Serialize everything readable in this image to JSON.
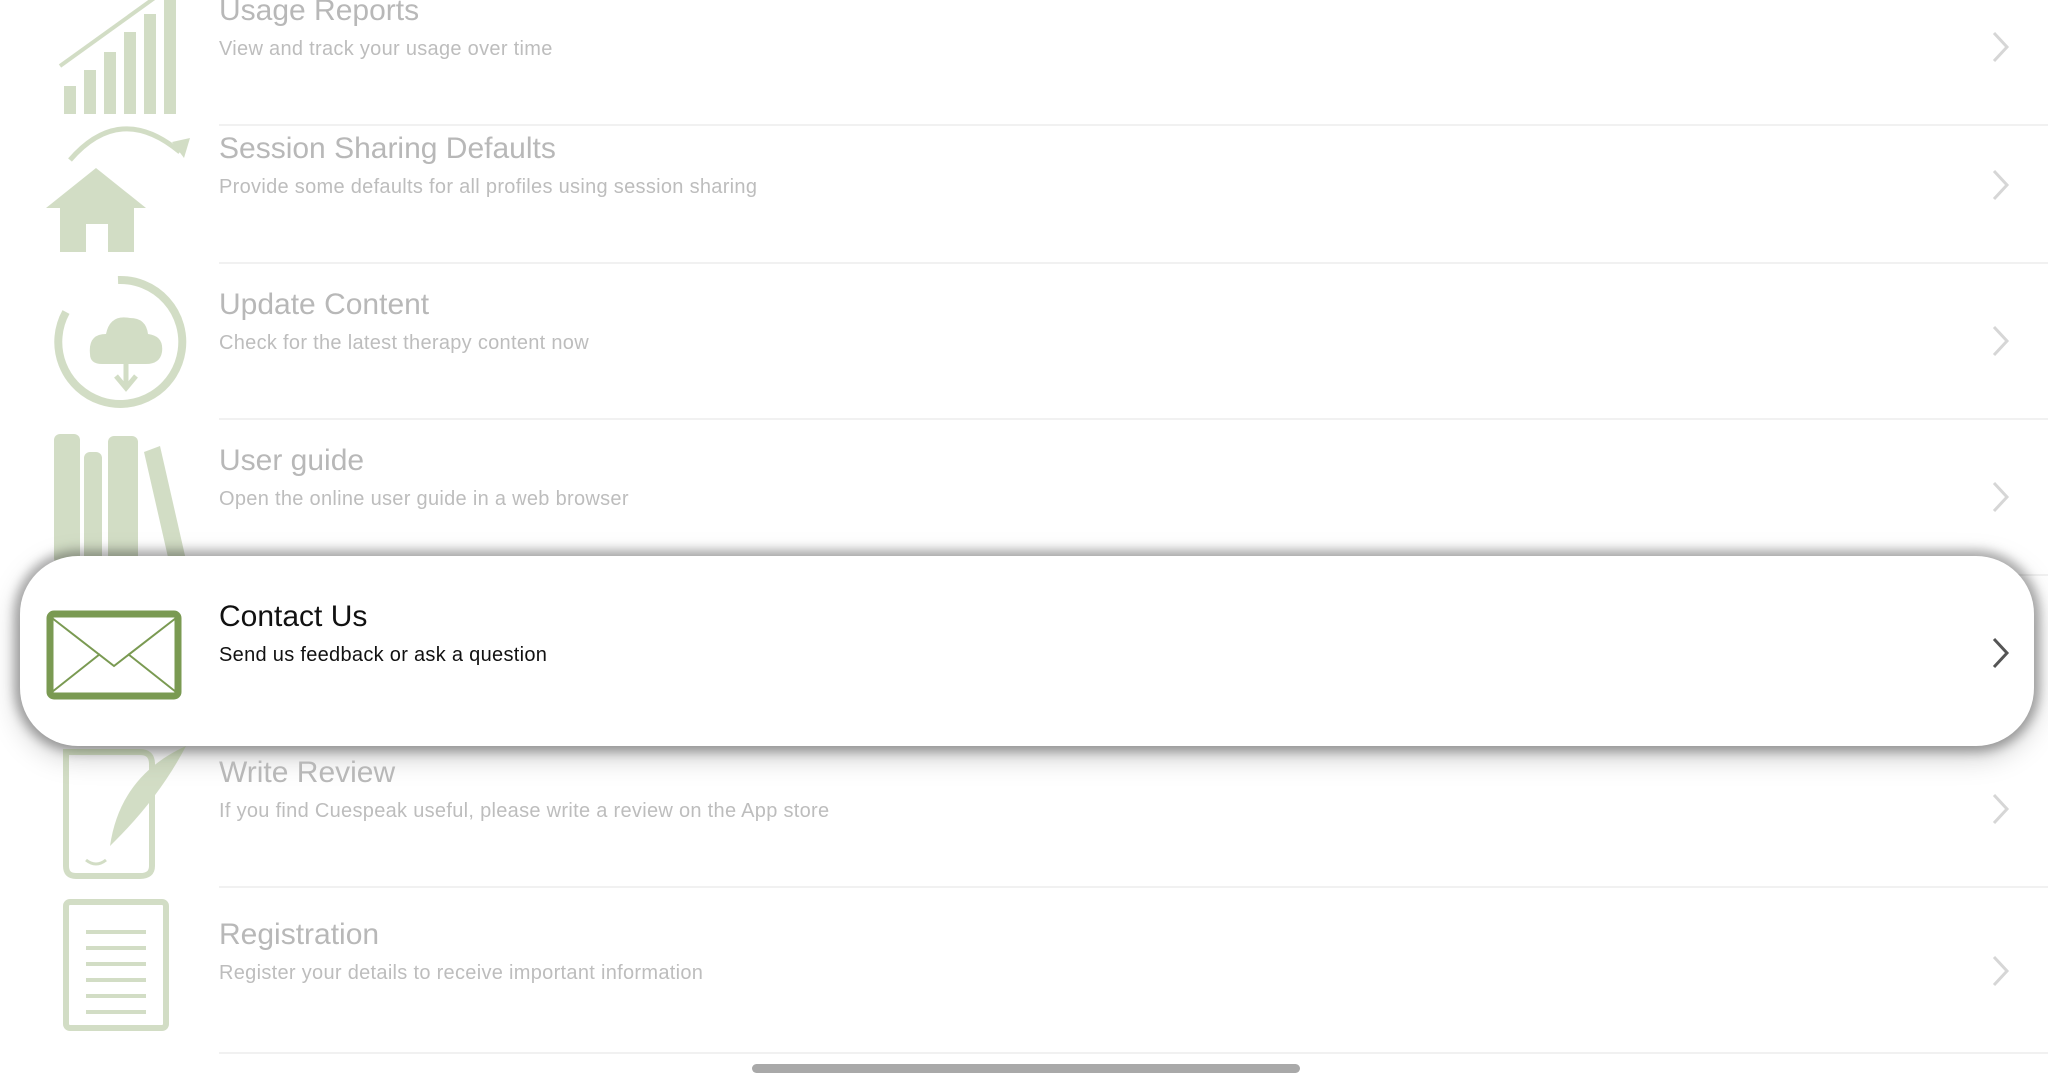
{
  "items": [
    {
      "title": "Usage Reports",
      "subtitle": "View and track your usage over time",
      "icon": "bar-chart-icon"
    },
    {
      "title": "Session Sharing Defaults",
      "subtitle": "Provide some defaults for all profiles using session sharing",
      "icon": "house-share-icon"
    },
    {
      "title": "Update Content",
      "subtitle": "Check for the latest therapy content now",
      "icon": "cloud-download-icon"
    },
    {
      "title": "User guide",
      "subtitle": "Open the online user guide in a web browser",
      "icon": "books-icon"
    },
    {
      "title": "Contact Us",
      "subtitle": "Send us feedback or ask a question",
      "icon": "envelope-icon"
    },
    {
      "title": "Write Review",
      "subtitle": "If you find Cuespeak useful, please write a review on the App store",
      "icon": "quill-icon"
    },
    {
      "title": "Registration",
      "subtitle": "Register your details to receive important information",
      "icon": "document-icon"
    }
  ],
  "colors": {
    "accent_green": "#7a9a52",
    "muted_green": "#c9d6b5",
    "text_muted": "#b8b8b8"
  }
}
